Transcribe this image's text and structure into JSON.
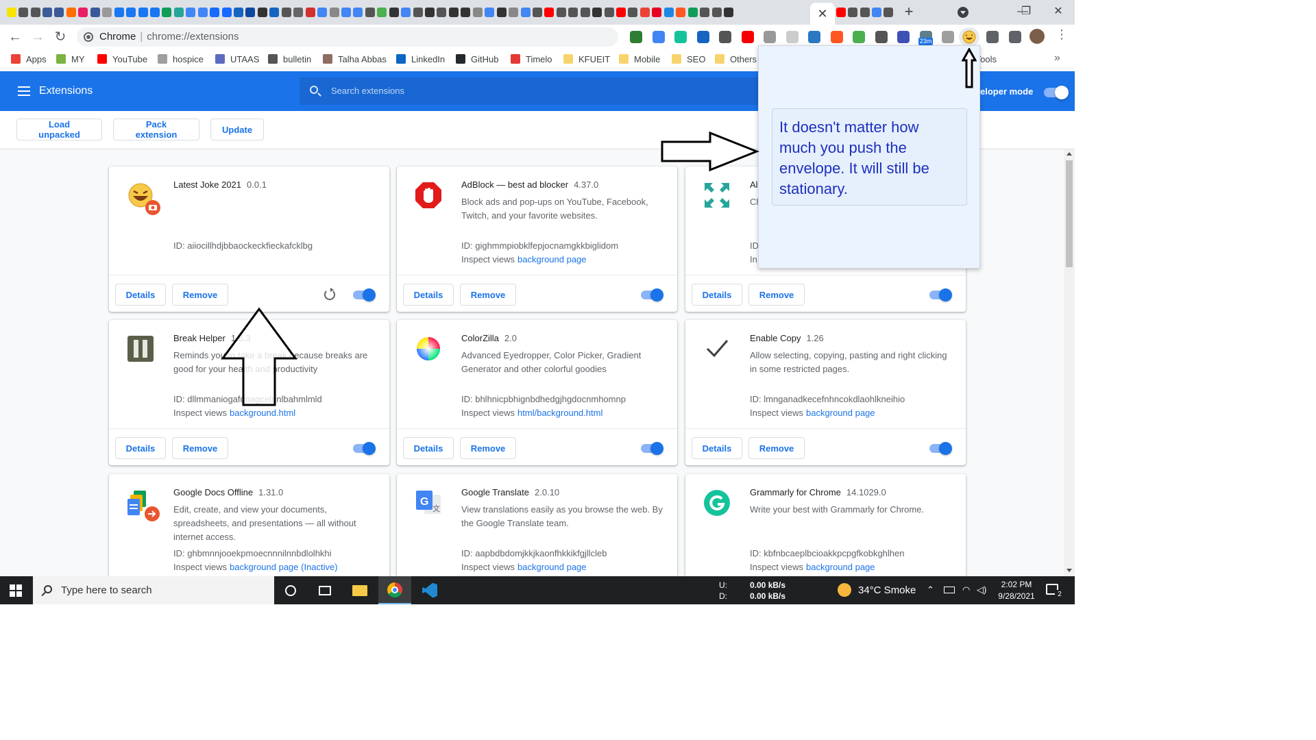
{
  "colors": {
    "brand": "#1a73e8",
    "header_bg": "#1a73e8",
    "popup_text": "#1e2fbd",
    "taskbar_bg": "#1e2022"
  },
  "tabstrip": {
    "active_tab_close": "✕",
    "new_tab": "+",
    "mini_tab_colors": [
      "#f7e400",
      "#555",
      "#555",
      "#3d5a99",
      "#3b5998",
      "#ff6f00",
      "#e91e63",
      "#3b5998",
      "#999",
      "#1877f2",
      "#1877f2",
      "#1877f2",
      "#1877f2",
      "#0f9d58",
      "#26a69a",
      "#4285f4",
      "#4285f4",
      "#1769ff",
      "#1769ff",
      "#1565c0",
      "#0d47a1",
      "#333",
      "#1565c0",
      "#555",
      "#666",
      "#d32f2f",
      "#4285f4",
      "#888",
      "#4285f4",
      "#4285f4",
      "#555",
      "#4caf50",
      "#333",
      "#4285f4",
      "#555",
      "#333",
      "#555",
      "#333",
      "#333",
      "#888",
      "#4285f4",
      "#333",
      "#888",
      "#4285f4",
      "#555",
      "#ff0000",
      "#555",
      "#555",
      "#555",
      "#333",
      "#555",
      "#ff0000",
      "#555",
      "#ea4335",
      "#e60023",
      "#1e88e5",
      "#ff5722",
      "#0f9d58",
      "#555",
      "#555",
      "#333"
    ],
    "mini_tab_colors_2": [
      "#ff0000",
      "#555",
      "#555",
      "#4285f4",
      "#555"
    ],
    "window_buttons": [
      "—",
      "❐",
      "✕"
    ]
  },
  "toolbar": {
    "back": "←",
    "forward": "→",
    "reload": "↻",
    "omnibox_scheme_label": "Chrome",
    "omnibox_separator": "|",
    "omnibox_url": "chrome://extensions",
    "star": "☆",
    "extension_icon_colors": [
      "#2e7d32",
      "#4285f4",
      "#15c39a",
      "#1565c0",
      "#555",
      "#f40000",
      "#999",
      "#ccc",
      "#2b78c2",
      "#ff5722",
      "#4caf50",
      "#555",
      "#3f51b5",
      "#607d8b",
      "#9e9e9e",
      "#f7c948",
      "#5f6368",
      "#5f6368"
    ],
    "ext_badge": "23m",
    "kebab": "⋮"
  },
  "bookmarks": [
    {
      "label": "Apps",
      "icon_color": "#ea4335"
    },
    {
      "label": "MY",
      "icon_color": "#7cb342"
    },
    {
      "label": "YouTube",
      "icon_color": "#ff0000"
    },
    {
      "label": "hospice",
      "icon_color": "#9e9e9e"
    },
    {
      "label": "UTAAS",
      "icon_color": "#5c6bc0"
    },
    {
      "label": "bulletin",
      "icon_color": "#555"
    },
    {
      "label": "Talha Abbas",
      "icon_color": "#8d6e63"
    },
    {
      "label": "LinkedIn",
      "icon_color": "#0a66c2"
    },
    {
      "label": "GitHub",
      "icon_color": "#24292e"
    },
    {
      "label": "Timelo",
      "icon_color": "#e53935"
    },
    {
      "label": "KFUEIT",
      "icon_color": "#f7d46b"
    },
    {
      "label": "Mobile",
      "icon_color": "#f7d46b"
    },
    {
      "label": "SEO",
      "icon_color": "#f7d46b"
    },
    {
      "label": "Others",
      "icon_color": "#f7d46b"
    },
    {
      "label": "o Tools",
      "icon_color": ""
    }
  ],
  "bookmarks_more": "»",
  "header": {
    "title": "Extensions",
    "search_placeholder": "Search extensions",
    "dev_mode_label": "eloper mode",
    "dev_mode_on": true
  },
  "actions": {
    "load_unpacked": "Load unpacked",
    "pack_extension": "Pack extension",
    "update": "Update"
  },
  "cards": [
    {
      "name": "Latest Joke 2021",
      "version": "0.0.1",
      "desc": "",
      "id": "ID: aiiocillhdjbbaockeckfieckafcklbg",
      "inspect_label": "",
      "inspect_link": "",
      "details": "Details",
      "remove": "Remove",
      "enabled": true,
      "reload": true,
      "icon": "laughing-emoji-icon"
    },
    {
      "name": "AdBlock — best ad blocker",
      "version": "4.37.0",
      "desc": "Block ads and pop-ups on YouTube, Facebook, Twitch, and your favorite websites.",
      "id": "ID: gighmmpiobklfepjocnamgkkbiglidom",
      "inspect_label": "Inspect views",
      "inspect_link": "background page",
      "details": "Details",
      "remove": "Remove",
      "enabled": true,
      "icon": "adblock-hand-icon"
    },
    {
      "name": "Al",
      "version": "",
      "desc": "Ch se se",
      "id": "ID",
      "inspect_label": "In",
      "inspect_link": "",
      "details": "Details",
      "remove": "Remove",
      "enabled": true,
      "icon": "expand-arrows-icon"
    },
    {
      "name": "Break Helper",
      "version": "1.6.3",
      "desc": "Reminds you to take a break because breaks are good for your health and productivity",
      "id": "ID: dllmmaniogafdnagcelnnlbahmlmld",
      "inspect_label": "Inspect views",
      "inspect_link": "background.html",
      "details": "Details",
      "remove": "Remove",
      "enabled": true,
      "icon": "pause-icon"
    },
    {
      "name": "ColorZilla",
      "version": "2.0",
      "desc": "Advanced Eyedropper, Color Picker, Gradient Generator and other colorful goodies",
      "id": "ID: bhlhnicpbhignbdhedgjhgdocnmhomnp",
      "inspect_label": "Inspect views",
      "inspect_link": "html/background.html",
      "details": "Details",
      "remove": "Remove",
      "enabled": true,
      "icon": "color-wheel-icon"
    },
    {
      "name": "Enable Copy",
      "version": "1.26",
      "desc": "Allow selecting, copying, pasting and right clicking in some restricted pages.",
      "id": "ID: lmnganadkecefnhncokdlaohlkneihio",
      "inspect_label": "Inspect views",
      "inspect_link": "background page",
      "details": "Details",
      "remove": "Remove",
      "enabled": true,
      "icon": "checkmark-icon"
    },
    {
      "name": "Google Docs Offline",
      "version": "1.31.0",
      "desc": "Edit, create, and view your documents, spreadsheets, and presentations — all without internet access.",
      "id": "ID: ghbmnnjooekpmoecnnnilnnbdlolhkhi",
      "inspect_label": "Inspect views",
      "inspect_link": "background page (Inactive)",
      "details": "Details",
      "remove": "Remove",
      "enabled": true,
      "icon": "google-docs-icon"
    },
    {
      "name": "Google Translate",
      "version": "2.0.10",
      "desc": "View translations easily as you browse the web. By the Google Translate team.",
      "id": "ID: aapbdbdomjkkjkaonfhkkikfgjllcleb",
      "inspect_label": "Inspect views",
      "inspect_link": "background page",
      "details": "Details",
      "remove": "Remove",
      "enabled": true,
      "icon": "google-translate-icon"
    },
    {
      "name": "Grammarly for Chrome",
      "version": "14.1029.0",
      "desc": "Write your best with Grammarly for Chrome.",
      "id": "ID: kbfnbcaeplbcioakkpcpgfkobkghlhen",
      "inspect_label": "Inspect views",
      "inspect_link": "background page",
      "details": "Details",
      "remove": "Remove",
      "enabled": true,
      "icon": "grammarly-icon"
    }
  ],
  "popup": {
    "joke": "It doesn't matter how much you push the envelope. It will still be stationary."
  },
  "taskbar": {
    "search_placeholder": "Type here to search",
    "net_up_label": "U:",
    "net_down_label": "D:",
    "net_up": "0.00 kB/s",
    "net_down": "0.00 kB/s",
    "weather": "34°C  Smoke",
    "time": "2:02 PM",
    "date": "9/28/2021",
    "notifications": "2"
  }
}
